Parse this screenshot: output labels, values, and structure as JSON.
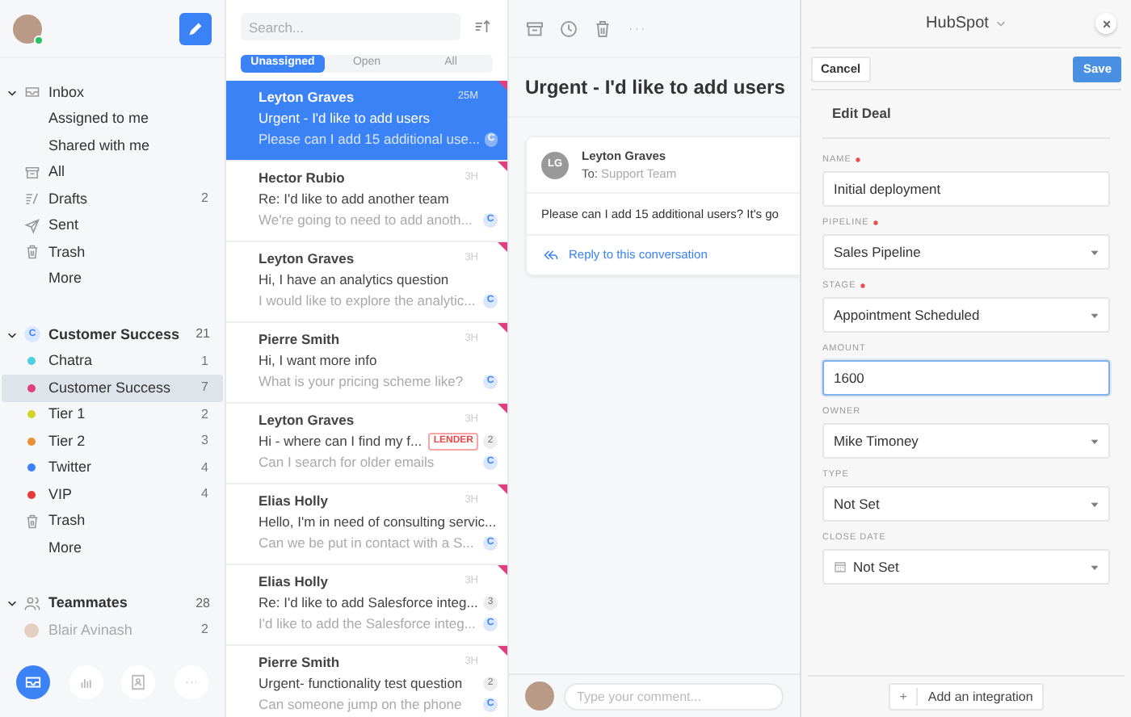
{
  "sidebar": {
    "user_online": true,
    "sections": [
      {
        "title": "Inbox",
        "kind": "inbox",
        "expanded": true,
        "items": [
          {
            "label": "Assigned to me",
            "kind": "plain",
            "selected": false
          },
          {
            "label": "Shared with me",
            "kind": "plain",
            "selected": false
          },
          {
            "label": "All",
            "kind": "archive",
            "selected": false
          },
          {
            "label": "Drafts",
            "kind": "drafts",
            "count": "2",
            "selected": false
          },
          {
            "label": "Sent",
            "kind": "sent",
            "selected": false
          },
          {
            "label": "Trash",
            "kind": "trash",
            "selected": false
          },
          {
            "label": "More",
            "kind": "plain",
            "selected": false
          }
        ]
      },
      {
        "title": "Customer Success",
        "kind": "team",
        "badge": "C",
        "count": "21",
        "expanded": true,
        "items": [
          {
            "label": "Chatra",
            "kind": "tag",
            "color": "#4dd0e1",
            "count": "1",
            "selected": false
          },
          {
            "label": "Customer Success",
            "kind": "tag",
            "color": "#e0407f",
            "count": "7",
            "selected": true
          },
          {
            "label": "Tier 1",
            "kind": "tag",
            "color": "#d4d42a",
            "count": "2",
            "selected": false
          },
          {
            "label": "Tier 2",
            "kind": "tag",
            "color": "#e8913a",
            "count": "3",
            "selected": false
          },
          {
            "label": "Twitter",
            "kind": "tag",
            "color": "#3b82f6",
            "count": "4",
            "selected": false
          },
          {
            "label": "VIP",
            "kind": "tag",
            "color": "#e53935",
            "count": "4",
            "selected": false
          },
          {
            "label": "Trash",
            "kind": "trash",
            "selected": false
          },
          {
            "label": "More",
            "kind": "plain",
            "selected": false
          }
        ]
      },
      {
        "title": "Teammates",
        "kind": "people",
        "count": "28",
        "expanded": true,
        "items": [
          {
            "label": "Blair Avinash",
            "kind": "person",
            "count": "2",
            "selected": false
          }
        ]
      }
    ]
  },
  "list": {
    "search": {
      "placeholder": "Search..."
    },
    "tabs": [
      {
        "label": "Unassigned",
        "selected": true
      },
      {
        "label": "Open",
        "selected": false
      },
      {
        "label": "All",
        "selected": false
      }
    ],
    "conversations": [
      {
        "name": "Leyton Graves",
        "time": "25M",
        "subject": "Urgent - I'd like to add users",
        "preview": "Please can I add 15 additional use...",
        "badge": "C",
        "selected": true
      },
      {
        "name": "Hector Rubio",
        "time": "3H",
        "subject": "Re: I'd like to add another team",
        "preview": "We're going to need to add anoth...",
        "badge": "C",
        "selected": false
      },
      {
        "name": "Leyton Graves",
        "time": "3H",
        "subject": "Hi, I have an analytics question",
        "preview": "I would like to explore the analytic...",
        "badge": "C",
        "selected": false
      },
      {
        "name": "Pierre Smith",
        "time": "3H",
        "subject": "Hi, I want more info",
        "preview": "What is your pricing scheme like?",
        "badge": "C",
        "selected": false
      },
      {
        "name": "Leyton Graves",
        "time": "3H",
        "subject": "Hi - where can I find my f...",
        "tag": "LENDER",
        "count": "2",
        "preview": "Can I search for older emails",
        "badge": "C",
        "selected": false
      },
      {
        "name": "Elias Holly",
        "time": "3H",
        "subject": "Hello, I'm in need of consulting servic...",
        "preview": "Can we be put in contact with a S...",
        "badge": "C",
        "selected": false
      },
      {
        "name": "Elias Holly",
        "time": "3H",
        "subject": "Re: I'd like to add Salesforce integ...",
        "count": "3",
        "preview": "I'd like to add the Salesforce integ...",
        "badge": "C",
        "selected": false
      },
      {
        "name": "Pierre Smith",
        "time": "3H",
        "subject": "Urgent- functionality test question",
        "count": "2",
        "preview": "Can someone jump on the phone",
        "badge": "C",
        "selected": false
      }
    ]
  },
  "conversation": {
    "title": "Urgent - I'd like to add users",
    "message": {
      "initials": "LG",
      "sender": "Leyton Graves",
      "to_label": "To:",
      "to": "Support Team",
      "body": "Please can I add 15 additional users? It's go",
      "reply": "Reply to this conversation"
    },
    "comment": {
      "placeholder": "Type your comment..."
    }
  },
  "hubspot": {
    "title": "HubSpot",
    "cancel": "Cancel",
    "save": "Save",
    "heading": "Edit Deal",
    "fields": [
      {
        "label": "NAME",
        "required": true,
        "kind": "text",
        "value": "Initial deployment",
        "focused": false
      },
      {
        "label": "PIPELINE",
        "required": true,
        "kind": "select",
        "value": "Sales Pipeline",
        "focused": false
      },
      {
        "label": "STAGE",
        "required": true,
        "kind": "select",
        "value": "Appointment Scheduled",
        "focused": false
      },
      {
        "label": "AMOUNT",
        "required": false,
        "kind": "text",
        "value": "1600",
        "focused": true
      },
      {
        "label": "OWNER",
        "required": false,
        "kind": "select",
        "value": "Mike Timoney",
        "focused": false
      },
      {
        "label": "TYPE",
        "required": false,
        "kind": "select",
        "value": "Not Set",
        "focused": false
      },
      {
        "label": "CLOSE DATE",
        "required": false,
        "kind": "date",
        "value": "Not Set",
        "focused": false
      }
    ],
    "add_button": {
      "icon": "+",
      "label": "Add an integration"
    }
  }
}
